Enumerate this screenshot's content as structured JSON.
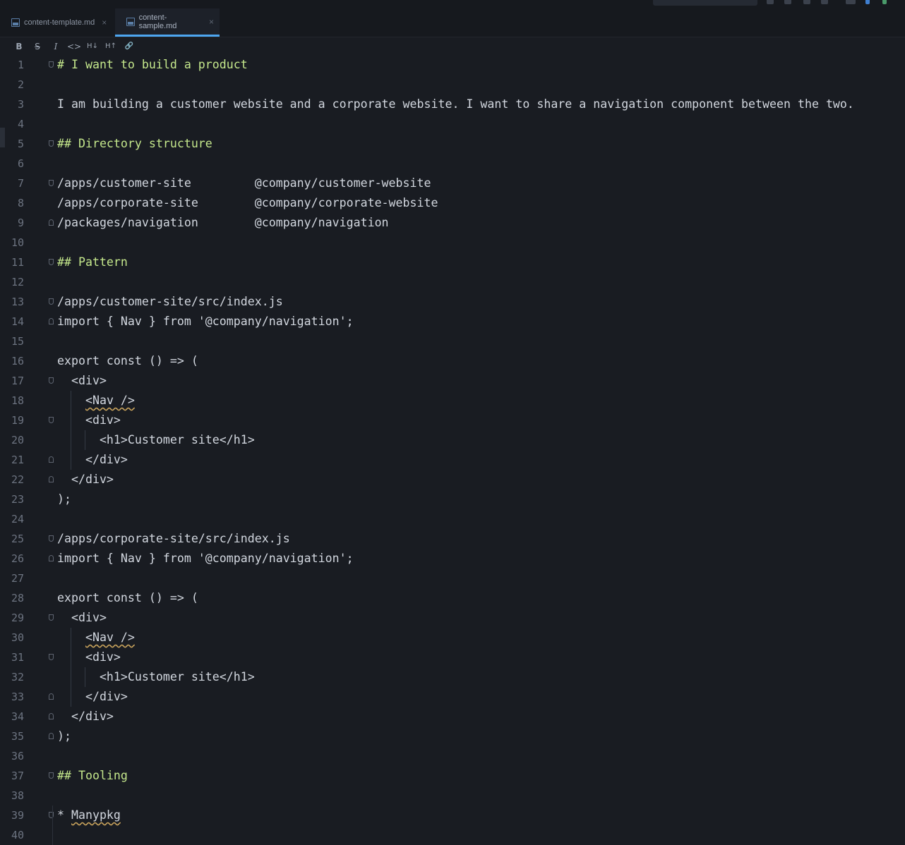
{
  "tabs": [
    {
      "label": "content-template.md",
      "active": false
    },
    {
      "label": "content-sample.md",
      "active": true
    }
  ],
  "toolbar": {
    "bold": "B",
    "strikethrough": "S",
    "italic": "I",
    "code": "<>",
    "heading_decrease": "H↓",
    "heading_increase": "H↑",
    "link": "🔗"
  },
  "editor": {
    "lines": [
      {
        "n": "1",
        "text": "# I want to build a product"
      },
      {
        "n": "2",
        "text": ""
      },
      {
        "n": "3",
        "text": "I am building a customer website and a corporate website. I want to share a navigation component between the two."
      },
      {
        "n": "4",
        "text": ""
      },
      {
        "n": "5",
        "text": "## Directory structure"
      },
      {
        "n": "6",
        "text": ""
      },
      {
        "n": "7",
        "text": "/apps/customer-site         @company/customer-website"
      },
      {
        "n": "8",
        "text": "/apps/corporate-site        @company/corporate-website"
      },
      {
        "n": "9",
        "text": "/packages/navigation        @company/navigation"
      },
      {
        "n": "10",
        "text": ""
      },
      {
        "n": "11",
        "text": "## Pattern"
      },
      {
        "n": "12",
        "text": ""
      },
      {
        "n": "13",
        "text": "/apps/customer-site/src/index.js"
      },
      {
        "n": "14",
        "text": "import { Nav } from '@company/navigation';"
      },
      {
        "n": "15",
        "text": ""
      },
      {
        "n": "16",
        "text": "export const () => ("
      },
      {
        "n": "17",
        "text": "  <div>"
      },
      {
        "n": "18",
        "text": "    <Nav />"
      },
      {
        "n": "19",
        "text": "    <div>"
      },
      {
        "n": "20",
        "text": "      <h1>Customer site</h1>"
      },
      {
        "n": "21",
        "text": "    </div>"
      },
      {
        "n": "22",
        "text": "  </div>"
      },
      {
        "n": "23",
        "text": ");"
      },
      {
        "n": "24",
        "text": ""
      },
      {
        "n": "25",
        "text": "/apps/corporate-site/src/index.js"
      },
      {
        "n": "26",
        "text": "import { Nav } from '@company/navigation';"
      },
      {
        "n": "27",
        "text": ""
      },
      {
        "n": "28",
        "text": "export const () => ("
      },
      {
        "n": "29",
        "text": "  <div>"
      },
      {
        "n": "30",
        "text": "    <Nav />"
      },
      {
        "n": "31",
        "text": "    <div>"
      },
      {
        "n": "32",
        "text": "      <h1>Customer site</h1>"
      },
      {
        "n": "33",
        "text": "    </div>"
      },
      {
        "n": "34",
        "text": "  </div>"
      },
      {
        "n": "35",
        "text": ");"
      },
      {
        "n": "36",
        "text": ""
      },
      {
        "n": "37",
        "text": "## Tooling"
      },
      {
        "n": "38",
        "text": ""
      },
      {
        "n": "39",
        "text": "* Manypkg"
      },
      {
        "n": "40",
        "text": ""
      }
    ]
  },
  "colors": {
    "background": "#191c22",
    "heading": "#c5e88c",
    "text": "#d2d7df",
    "line_number": "#6c7380",
    "tab_accent": "#4ea6f0",
    "spell_underline": "#c6a15b"
  }
}
